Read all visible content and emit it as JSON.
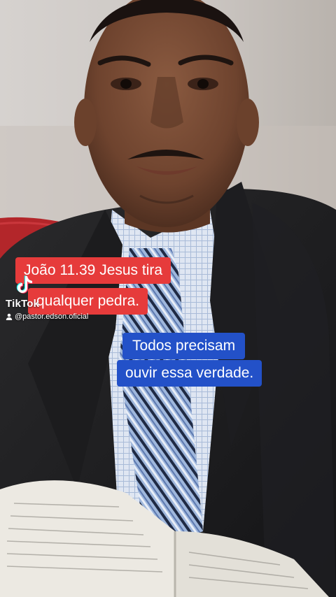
{
  "watermark": {
    "brand": "TikTok",
    "username": "@pastor.edson.oficial",
    "logo_icon": "tiktok-note-icon",
    "user_icon": "person-icon"
  },
  "captions": {
    "red_line1": "João 11.39 Jesus tira",
    "red_line2": "qualquer pedra.",
    "blue_line1": "Todos precisam",
    "blue_line2": "ouvir essa verdade."
  },
  "colors": {
    "red_caption_bg": "#e63b3b",
    "blue_caption_bg": "#2351c8",
    "text": "#ffffff"
  }
}
